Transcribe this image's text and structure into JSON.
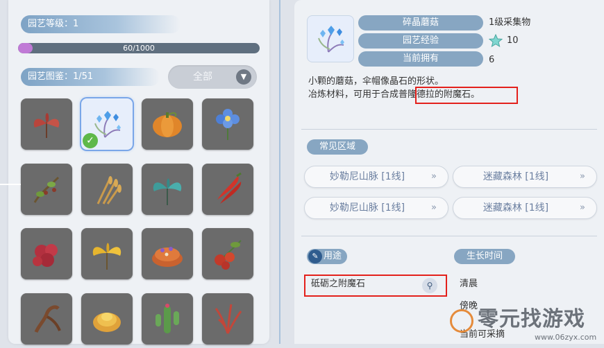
{
  "left": {
    "garden_level": "园艺等级：1",
    "progress": {
      "text": "60/1000",
      "fraction": 0.06
    },
    "catalog_label": "园艺图鉴：1/51",
    "filter": {
      "label": "全部"
    },
    "items": [
      "red-leaf-plant-icon",
      "crystal-mushroom-icon",
      "pumpkin-icon",
      "blue-flower-icon",
      "vine-berry-icon",
      "wheat-icon",
      "teal-leaf-plant-icon",
      "red-chili-icon",
      "raspberry-icon",
      "yellow-leaf-plant-icon",
      "mushroom-cap-icon",
      "tomato-vine-icon",
      "root-plant-icon",
      "succulent-icon",
      "cactus-icon",
      "red-grass-icon"
    ]
  },
  "right": {
    "item_name": "碎晶蘑菇",
    "item_grade": "1级采集物",
    "xp_label": "园艺经验",
    "xp_value": "10",
    "owned_label": "当前拥有",
    "owned_value": "6",
    "description_line1": "小颗的蘑菇，伞帽像晶石的形状。",
    "description_line2": "冶炼材料，可用于合成普隆德拉的附魔石。",
    "regions_header": "常见区域",
    "regions": [
      "妙勒尼山脉 [1线]",
      "迷藏森林 [1线]",
      "妙勒尼山脉 [1线]",
      "迷藏森林 [1线]"
    ],
    "use_header": "用途",
    "use_item": "砥砺之附魔石",
    "growth_header": "生长时间",
    "growth_times": [
      "清晨",
      "傍晚",
      "当前可采摘"
    ]
  },
  "watermark": {
    "text": "零元找游戏",
    "url": "www.06zyx.com"
  },
  "colors": {
    "accent": "#87a6c2",
    "highlight": "#e3201b",
    "progress": "#c07ad6"
  }
}
